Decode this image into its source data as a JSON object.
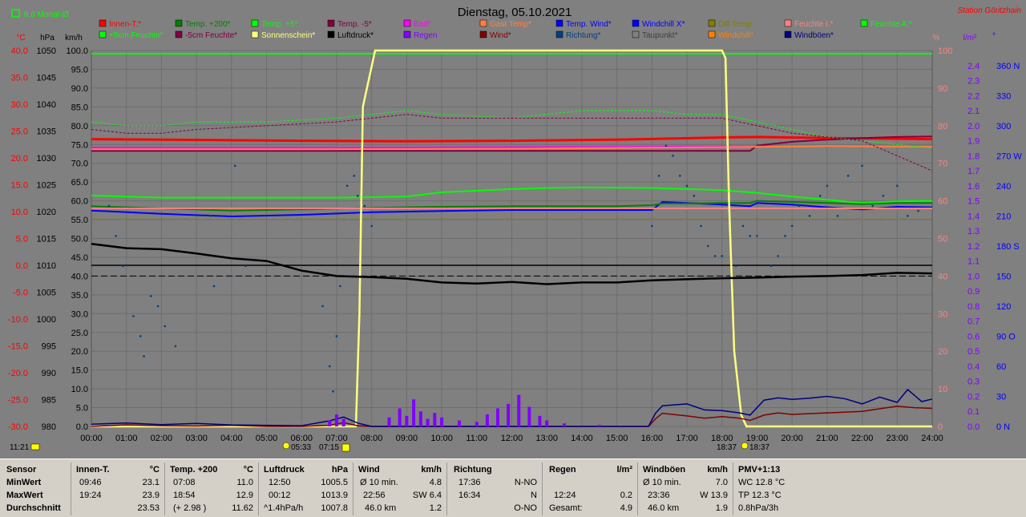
{
  "header": {
    "title": "Dienstag, 05.10.2021",
    "station": "Station Göritzhain",
    "month_avg": "8.6 Monat-Ø",
    "time_marker": "11:21"
  },
  "legend": [
    {
      "label": "Innen-T.*",
      "color": "#ff0000"
    },
    {
      "label": "Temp. +200*",
      "color": "#008000"
    },
    {
      "label": "Temp. +5*",
      "color": "#00ff00"
    },
    {
      "label": "Temp. -5*",
      "color": "#800040"
    },
    {
      "label": "Bad*",
      "color": "#ff00ff"
    },
    {
      "label": "Gast Temp*",
      "color": "#ff8040"
    },
    {
      "label": "Temp. Wind*",
      "color": "#0000ff"
    },
    {
      "label": "Windchill X*",
      "color": "#0000ff"
    },
    {
      "label": "Diff Temp.",
      "color": "#808000"
    },
    {
      "label": "Feuchte I.*",
      "color": "#ff8080"
    },
    {
      "label": "Feuchte A.*",
      "color": "#00ff00"
    },
    {
      "label": "+5cm Feuchte*",
      "color": "#00ff00"
    },
    {
      "label": "-5cm Feuchte*",
      "color": "#800040"
    },
    {
      "label": "Sonnenschein*",
      "color": "#ffff80"
    },
    {
      "label": "Luftdruck*",
      "color": "#000000"
    },
    {
      "label": "Regen",
      "color": "#8000ff"
    },
    {
      "label": "Wind*",
      "color": "#800000"
    },
    {
      "label": "Richtung*",
      "color": "#004080"
    },
    {
      "label": "Taupunkt*",
      "color": "#808080"
    },
    {
      "label": "Windchill*",
      "color": "#ff8000"
    },
    {
      "label": "Windböen*",
      "color": "#000080"
    }
  ],
  "axes": {
    "temp_unit": "°C",
    "hpa_unit": "hPa",
    "kmh_unit": "km/h",
    "pct_unit": "%",
    "rain_unit": "l/m²",
    "deg_unit": "°",
    "temp_ticks": [
      "40.0",
      "35.0",
      "30.0",
      "25.0",
      "20.0",
      "15.0",
      "10.0",
      "5.0",
      "0.0",
      "-5.0",
      "-10.0",
      "-15.0",
      "-20.0",
      "-25.0",
      "-30.0"
    ],
    "hpa_ticks": [
      "1050",
      "1045",
      "1040",
      "1035",
      "1030",
      "1025",
      "1020",
      "1015",
      "1010",
      "1005",
      "1000",
      "995",
      "990",
      "985",
      "980"
    ],
    "kmh_ticks": [
      "100.0",
      "95.0",
      "90.0",
      "85.0",
      "80.0",
      "75.0",
      "70.0",
      "65.0",
      "60.0",
      "55.0",
      "50.0",
      "45.0",
      "40.0",
      "35.0",
      "30.0",
      "25.0",
      "20.0",
      "15.0",
      "10.0",
      "5.0",
      "0.0"
    ],
    "pct_ticks": [
      "100",
      "90",
      "80",
      "70",
      "60",
      "50",
      "40",
      "30",
      "20",
      "10",
      "0"
    ],
    "rain_ticks": [
      "2.4",
      "2.3",
      "2.2",
      "2.1",
      "2.0",
      "1.9",
      "1.8",
      "1.7",
      "1.6",
      "1.5",
      "1.4",
      "1.3",
      "1.2",
      "1.1",
      "1.0",
      "0.9",
      "0.8",
      "0.7",
      "0.6",
      "0.5",
      "0.4",
      "0.3",
      "0.2",
      "0.1",
      "0.0"
    ],
    "deg_ticks": [
      "360 N",
      "330",
      "300",
      "270 W",
      "240",
      "210",
      "180 S",
      "150",
      "120",
      "90 O",
      "60",
      "30",
      "0 N"
    ],
    "time_ticks": [
      "00:00",
      "01:00",
      "02:00",
      "03:00",
      "04:00",
      "05:00",
      "06:00",
      "07:00",
      "08:00",
      "09:00",
      "10:00",
      "11:00",
      "12:00",
      "13:00",
      "14:00",
      "15:00",
      "16:00",
      "17:00",
      "18:00",
      "19:00",
      "20:00",
      "21:00",
      "22:00",
      "23:00",
      "24:00"
    ],
    "sunrise_label": "05:33",
    "sunrise_label2": "07:15",
    "sunset_label": "18:37",
    "sunset_label2": "18:37"
  },
  "chart_data": {
    "type": "line",
    "title": "Dienstag, 05.10.2021",
    "x_range": [
      "00:00",
      "24:00"
    ],
    "ylim_temp": [
      -30,
      40
    ],
    "ylim_pressure": [
      980,
      1050
    ],
    "ylim_wind": [
      0,
      100
    ],
    "ylim_humidity": [
      0,
      100
    ],
    "ylim_rain": [
      0,
      2.5
    ],
    "grid": true,
    "series": [
      {
        "name": "Innen-T.*",
        "axis": "temp",
        "color": "#ff0000",
        "x": [
          0,
          6,
          9,
          12,
          15,
          18,
          19,
          21,
          24
        ],
        "y": [
          23.5,
          23.2,
          23.1,
          23.2,
          23.4,
          23.8,
          23.9,
          23.7,
          23.5
        ]
      },
      {
        "name": "Temp. +5*",
        "axis": "temp",
        "color": "#00ff00",
        "x": [
          0,
          1,
          2,
          5,
          7,
          9,
          10,
          12,
          13,
          14,
          16,
          17,
          18,
          19,
          20,
          21,
          22,
          23,
          24
        ],
        "y": [
          13.0,
          12.8,
          12.6,
          12.6,
          12.6,
          12.8,
          13.6,
          14.2,
          14.4,
          14.5,
          14.4,
          14.2,
          14.0,
          13.5,
          12.8,
          12.2,
          11.6,
          11.9,
          12.0
        ]
      },
      {
        "name": "Temp. Wind*",
        "axis": "temp",
        "color": "#0000ff",
        "x": [
          0,
          2,
          4,
          6,
          8,
          10,
          12,
          15,
          16,
          16.3,
          17,
          18,
          18.8,
          19,
          20,
          21,
          22,
          23,
          24
        ],
        "y": [
          10.2,
          9.6,
          9.1,
          9.4,
          9.9,
          10.1,
          10.3,
          10.3,
          10.3,
          11.8,
          11.6,
          11.3,
          11.0,
          11.6,
          11.3,
          10.8,
          10.4,
          10.9,
          10.8
        ]
      },
      {
        "name": "Temp. +200*",
        "axis": "temp",
        "color": "#008000",
        "x": [
          0,
          2,
          4,
          6,
          8,
          10,
          12,
          15,
          16,
          16.3,
          17,
          18,
          18.8,
          19,
          20,
          21,
          22,
          23,
          24
        ],
        "y": [
          11.0,
          10.6,
          10.2,
          10.4,
          10.7,
          10.9,
          11.0,
          11.0,
          11.2,
          11.5,
          11.5,
          11.6,
          11.6,
          12.0,
          11.8,
          11.6,
          11.4,
          11.6,
          11.6
        ]
      },
      {
        "name": "Temp. -5*",
        "axis": "temp",
        "color": "#800040",
        "x": [
          0,
          6,
          12,
          17,
          18.8,
          19,
          20,
          21,
          22,
          23,
          24
        ],
        "y": [
          21.3,
          21.3,
          21.3,
          21.3,
          21.3,
          22.3,
          23.0,
          23.4,
          23.7,
          23.9,
          24.0
        ]
      },
      {
        "name": "Bad*",
        "axis": "temp",
        "color": "#ff00ff",
        "x": [
          0,
          6,
          12,
          18,
          21,
          24
        ],
        "y": [
          21.9,
          21.9,
          22.0,
          22.1,
          22.2,
          22.2
        ]
      },
      {
        "name": "Gast Temp*",
        "axis": "temp",
        "color": "#ff8040",
        "x": [
          0,
          6,
          12,
          18,
          21,
          24
        ],
        "y": [
          21.6,
          21.6,
          21.7,
          22.0,
          22.2,
          22.1
        ]
      },
      {
        "name": "Feuchte I.*",
        "axis": "temp",
        "color": "#ff8080",
        "x": [
          0,
          6,
          12,
          18,
          21,
          24
        ],
        "y": [
          10.6,
          10.6,
          10.6,
          10.6,
          10.6,
          10.6
        ]
      },
      {
        "name": "Diff Temp.",
        "axis": "temp",
        "color": "#808000",
        "x": [
          0,
          24
        ],
        "y": [
          8.6,
          8.6
        ]
      },
      {
        "name": "+5cm Feuchte*",
        "axis": "hum",
        "color": "#00ff00",
        "x": [
          0,
          1,
          2,
          3,
          5,
          7,
          8,
          9,
          10,
          12,
          14,
          16,
          17,
          18,
          19,
          20,
          21,
          22,
          23,
          24
        ],
        "y": [
          81,
          80,
          80,
          81,
          81,
          82,
          83,
          84,
          83,
          82,
          84,
          84,
          83,
          83,
          81,
          79,
          77,
          76,
          75,
          74
        ]
      },
      {
        "name": "-5cm Feuchte*",
        "axis": "hum",
        "color": "#800040",
        "x": [
          0,
          1,
          2,
          3,
          5,
          7,
          8,
          9,
          10,
          12,
          14,
          16,
          17,
          18,
          19,
          20,
          21,
          22,
          23,
          24
        ],
        "y": [
          79,
          78,
          78,
          79,
          80,
          81,
          82,
          83,
          82,
          82,
          82,
          82,
          82,
          82,
          80,
          78,
          77,
          76,
          72,
          68
        ]
      },
      {
        "name": "Sonnenschein*",
        "axis": "hum",
        "color": "#ffff80",
        "x": [
          0,
          7.55,
          7.65,
          7.75,
          8.1,
          8.3,
          9,
          12,
          15,
          18,
          18.1,
          18.2,
          18.35,
          18.55,
          18.7,
          24
        ],
        "y": [
          0,
          0,
          30,
          85,
          100,
          100,
          100,
          100,
          100,
          100,
          98,
          60,
          20,
          3,
          0,
          0
        ]
      },
      {
        "name": "Luftdruck*",
        "axis": "hpa",
        "color": "#000000",
        "x": [
          0,
          1,
          2,
          3,
          4,
          5,
          6,
          7,
          8,
          9,
          10,
          11,
          12,
          13,
          14,
          15,
          16,
          17,
          18,
          19,
          20,
          21,
          22,
          23,
          24
        ],
        "y": [
          1014.0,
          1013.2,
          1013.0,
          1012.2,
          1011.3,
          1010.8,
          1009.0,
          1008.0,
          1007.8,
          1007.5,
          1006.8,
          1006.6,
          1006.9,
          1006.5,
          1006.8,
          1006.8,
          1007.2,
          1007.4,
          1007.6,
          1007.7,
          1007.9,
          1008.0,
          1008.2,
          1008.6,
          1008.5
        ]
      },
      {
        "name": "Wind*",
        "axis": "wind",
        "color": "#800000",
        "x": [
          0,
          1,
          2,
          3,
          4,
          5,
          6,
          6.8,
          7.2,
          7.6,
          8,
          12,
          15.9,
          16.1,
          16.3,
          17,
          17.5,
          18,
          18.5,
          18.8,
          19.2,
          19.6,
          20,
          21,
          22,
          23,
          23.5,
          24
        ],
        "y": [
          0,
          0.4,
          0.2,
          0.1,
          0.3,
          0,
          0,
          0.3,
          1.0,
          0.2,
          0,
          0,
          0,
          2.0,
          3.5,
          2.8,
          2.2,
          2.6,
          2.2,
          1.6,
          3.0,
          3.6,
          3.2,
          3.6,
          4.0,
          5.4,
          5.0,
          4.8
        ]
      },
      {
        "name": "Windböen*",
        "axis": "wind",
        "color": "#000080",
        "x": [
          0,
          1,
          2,
          3,
          4,
          5,
          6,
          6.8,
          7.2,
          7.6,
          8,
          12,
          15.9,
          16.1,
          16.3,
          17,
          17.5,
          18,
          18.5,
          18.8,
          19.2,
          19.6,
          20,
          20.5,
          21,
          21.5,
          22,
          22.5,
          23,
          23.3,
          23.7,
          24
        ],
        "y": [
          0.6,
          0.9,
          0.5,
          0.8,
          0.4,
          0.3,
          0.2,
          1.5,
          2.5,
          0.9,
          0,
          0,
          0,
          3.5,
          5.5,
          6.0,
          4.4,
          4.2,
          3.6,
          3.0,
          7.0,
          7.6,
          7.2,
          7.5,
          8.0,
          7.4,
          6.0,
          7.8,
          6.4,
          9.8,
          6.6,
          7.3
        ]
      },
      {
        "name": "Regen",
        "axis": "rain",
        "color": "#8000ff",
        "type": "bar",
        "x": [
          0.5,
          6.8,
          7.0,
          7.2,
          8.5,
          8.8,
          9.0,
          9.2,
          9.4,
          9.6,
          9.8,
          10.0,
          10.5,
          11.0,
          11.3,
          11.6,
          11.9,
          12.2,
          12.5,
          12.8,
          13.0,
          13.5,
          14.5
        ],
        "y": [
          0.01,
          0.04,
          0.08,
          0.05,
          0.06,
          0.12,
          0.07,
          0.18,
          0.1,
          0.05,
          0.09,
          0.06,
          0.04,
          0.03,
          0.08,
          0.12,
          0.15,
          0.21,
          0.13,
          0.07,
          0.04,
          0.02,
          0.01
        ]
      },
      {
        "name": "Richtung*",
        "axis": "deg",
        "color": "#004080",
        "type": "scatter",
        "x": [
          0.5,
          0.7,
          0.9,
          1.2,
          1.4,
          1.5,
          1.7,
          1.9,
          2.1,
          2.4,
          3.4,
          3.5,
          3.9,
          4.1,
          4.4,
          6.6,
          6.8,
          6.9,
          7.0,
          7.1,
          7.3,
          7.5,
          7.6,
          7.8,
          8.0,
          16.0,
          16.2,
          16.4,
          16.6,
          16.8,
          17.0,
          17.2,
          17.4,
          17.6,
          17.8,
          18.0,
          18.2,
          18.4,
          18.6,
          18.8,
          19.0,
          19.4,
          19.6,
          19.8,
          20.0,
          20.2,
          20.5,
          20.8,
          21.0,
          21.3,
          21.6,
          22.0,
          22.3,
          22.6,
          23.0,
          23.3,
          23.6
        ],
        "y": [
          220,
          190,
          160,
          110,
          90,
          70,
          130,
          120,
          100,
          80,
          210,
          140,
          150,
          260,
          160,
          120,
          60,
          35,
          90,
          140,
          240,
          250,
          230,
          220,
          200,
          200,
          250,
          280,
          270,
          250,
          240,
          230,
          200,
          180,
          170,
          170,
          150,
          160,
          200,
          190,
          190,
          160,
          170,
          190,
          200,
          220,
          210,
          230,
          240,
          210,
          250,
          260,
          220,
          230,
          240,
          210,
          215
        ]
      }
    ]
  },
  "stats": {
    "sensor": {
      "header": "Sensor",
      "min": "MinWert",
      "max": "MaxWert",
      "avg": "Durchschnitt"
    },
    "innen": {
      "header": "Innen-T.",
      "unit": "°C",
      "min_time": "09:46",
      "min_val": "23.1",
      "max_time": "19:24",
      "max_val": "23.9",
      "avg_val": "23.53"
    },
    "temp200": {
      "header": "Temp. +200",
      "unit": "°C",
      "min_time": "07:08",
      "min_val": "11.0",
      "max_time": "18:54",
      "max_val": "12.9",
      "avg_time": "(+ 2.98 )",
      "avg_val": "11.62"
    },
    "luftdruck": {
      "header": "Luftdruck",
      "unit": "hPa",
      "min_time": "12:50",
      "min_val": "1005.5",
      "max_time": "00:12",
      "max_val": "1013.9",
      "avg_time": "^1.4hPa/h",
      "avg_val": "1007.8"
    },
    "wind": {
      "header": "Wind",
      "unit": "km/h",
      "min_time": "Ø 10 min.",
      "min_val": "4.8",
      "max_time": "22:56",
      "max_val": "SW 6.4",
      "avg_time": "46.0 km",
      "avg_val": "1.2"
    },
    "richtung": {
      "header": "Richtung",
      "min_time": "17:36",
      "min_val": "N-NO",
      "max_time": "16:34",
      "max_val": "N",
      "avg_val": "O-NO"
    },
    "regen": {
      "header": "Regen",
      "unit": "l/m²",
      "max_time": "12:24",
      "max_val": "0.2",
      "avg_time": "Gesamt:",
      "avg_val": "4.9"
    },
    "windboeen": {
      "header": "Windböen",
      "unit": "km/h",
      "min_time": "Ø 10 min.",
      "min_val": "7.0",
      "max_time": "23:36",
      "max_val": "W 13.9",
      "avg_time": "46.0 km",
      "avg_val": "1.9"
    },
    "pmv": {
      "header": "PMV+1:13",
      "min": "WC 12.8 °C",
      "max": "TP 12.3 °C",
      "avg": "0.8hPa/3h"
    }
  }
}
